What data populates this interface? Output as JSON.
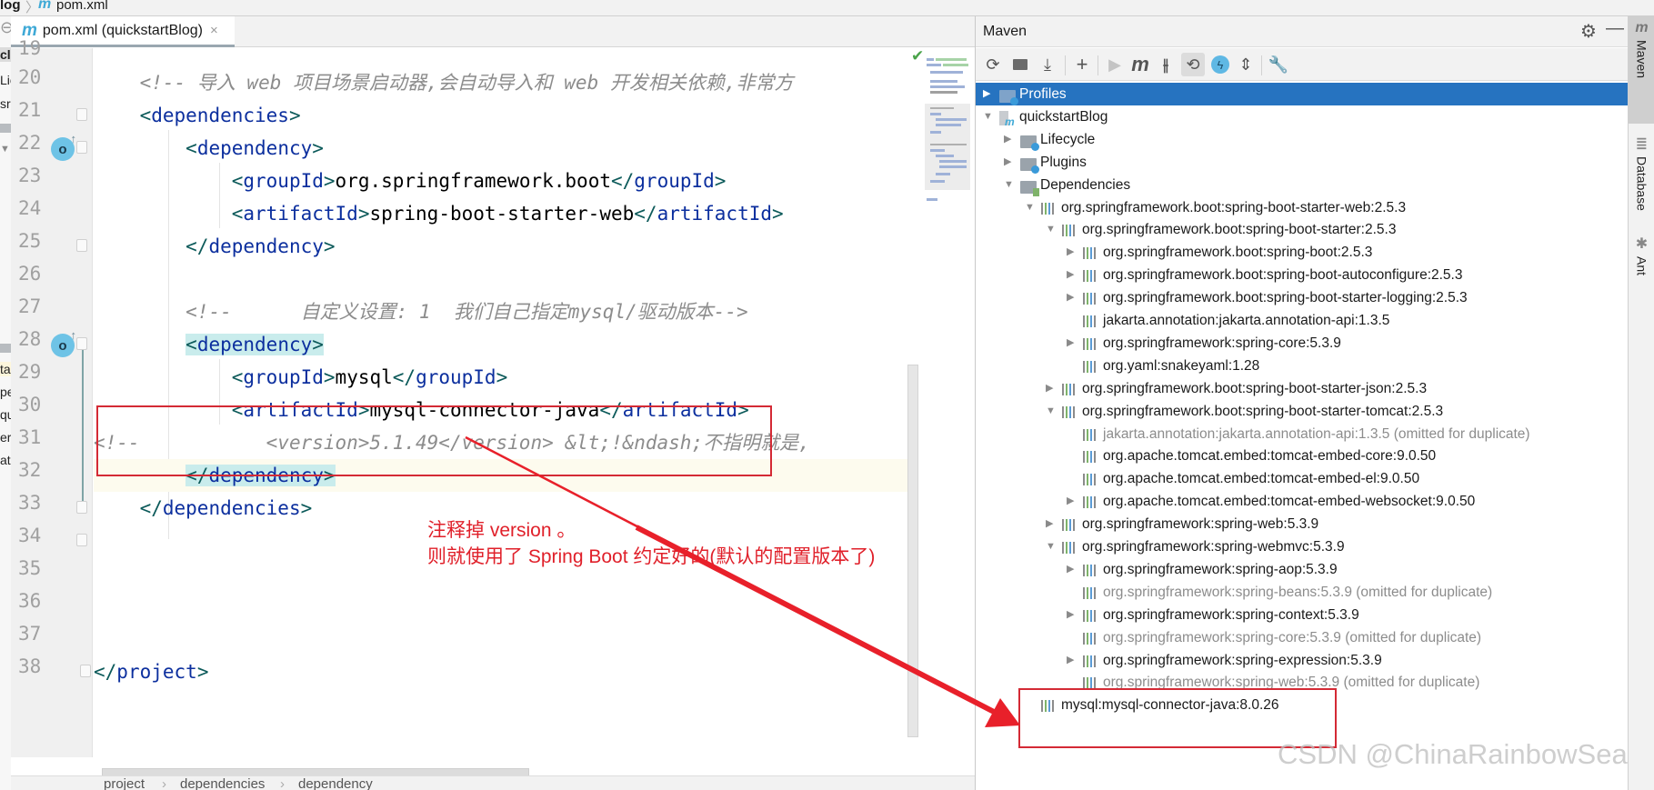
{
  "top_breadcrumb": {
    "project": "log",
    "file": "pom.xml"
  },
  "left_panel_fragments": [
    "cl",
    "Lic",
    "sr",
    "ta",
    "pe",
    "qu",
    "er",
    "at"
  ],
  "editor": {
    "tab": {
      "label": "pom.xml (quickstartBlog)",
      "icon": "maven-m-icon",
      "close": "×"
    },
    "line_numbers": [
      "19",
      "20",
      "21",
      "22",
      "23",
      "24",
      "25",
      "26",
      "27",
      "28",
      "29",
      "30",
      "31",
      "32",
      "33",
      "34",
      "35",
      "36",
      "37",
      "38"
    ],
    "lines": {
      "l20": "<!-- 导入 web 项目场景启动器,会自动导入和 web 开发相关依赖,非常方",
      "l21_open": "<",
      "l21_tag": "dependencies",
      "l21_close": ">",
      "l22_tag": "dependency",
      "l23_open_tag": "groupId",
      "l23_text": "org.springframework.boot",
      "l23_close_tag": "groupId",
      "l24_open_tag": "artifactId",
      "l24_text": "spring-boot-starter-web",
      "l24_close_tag": "artifactId",
      "l25_tag": "dependency",
      "l27": "<!--      自定义设置: 1  我们自己指定mysql/驱动版本-->",
      "l28_tag": "dependency",
      "l29_open_tag": "groupId",
      "l29_text": "mysql",
      "l29_close_tag": "groupId",
      "l30_open_tag": "artifactId",
      "l30_text": "mysql-connector-java",
      "l30_close_tag": "artifactId",
      "l31_a": "<!--",
      "l31_b": "<version>5.1.49</version> &lt;!&ndash;不指明就是,",
      "l32_tag": "dependency",
      "l33_tag": "dependencies",
      "l38_tag": "project"
    },
    "inspection_status": "✔",
    "breadcrumb": [
      "project",
      "dependencies",
      "dependency"
    ],
    "breadcrumb_sep": "›"
  },
  "annotation": {
    "note_line1": "注释掉 version 。",
    "note_line2": "则就使用了 Spring Boot 约定好的(默认的配置版本了)",
    "color": "#e0202a"
  },
  "maven": {
    "title": "Maven",
    "header_icons": [
      "gear-icon",
      "minimize-icon"
    ],
    "toolbar": [
      {
        "name": "reload-all-projects",
        "glyph": "⟳"
      },
      {
        "name": "generate-sources",
        "glyph": "▚"
      },
      {
        "name": "download-sources",
        "glyph": "⤓"
      },
      {
        "name": "add-maven-project",
        "glyph": "+"
      },
      {
        "name": "run-maven-build",
        "glyph": "▶"
      },
      {
        "name": "execute-maven-goal",
        "glyph": "m"
      },
      {
        "name": "toggle-offline-mode",
        "glyph": "⫲"
      },
      {
        "name": "toggle-skip-tests",
        "glyph": "⟲"
      },
      {
        "name": "show-dependencies",
        "glyph": "ϟ"
      },
      {
        "name": "collapse-all",
        "glyph": "⇕"
      },
      {
        "name": "maven-settings",
        "glyph": "🔧"
      }
    ],
    "tree": [
      {
        "label": "Profiles",
        "level": 0,
        "toggle": "▶",
        "icon": "profiles-folder",
        "selected": true
      },
      {
        "label": "quickstartBlog",
        "level": 0,
        "toggle": "▼",
        "icon": "maven-module"
      },
      {
        "label": "Lifecycle",
        "level": 1,
        "toggle": "▶",
        "icon": "gear-folder"
      },
      {
        "label": "Plugins",
        "level": 1,
        "toggle": "▶",
        "icon": "gear-folder"
      },
      {
        "label": "Dependencies",
        "level": 1,
        "toggle": "▼",
        "icon": "deps-folder"
      },
      {
        "label": "org.springframework.boot:spring-boot-starter-web:2.5.3",
        "level": 2,
        "toggle": "▼",
        "icon": "library"
      },
      {
        "label": "org.springframework.boot:spring-boot-starter:2.5.3",
        "level": 3,
        "toggle": "▼",
        "icon": "library"
      },
      {
        "label": "org.springframework.boot:spring-boot:2.5.3",
        "level": 4,
        "toggle": "▶",
        "icon": "library"
      },
      {
        "label": "org.springframework.boot:spring-boot-autoconfigure:2.5.3",
        "level": 4,
        "toggle": "▶",
        "icon": "library"
      },
      {
        "label": "org.springframework.boot:spring-boot-starter-logging:2.5.3",
        "level": 4,
        "toggle": "▶",
        "icon": "library"
      },
      {
        "label": "jakarta.annotation:jakarta.annotation-api:1.3.5",
        "level": 4,
        "toggle": "",
        "icon": "library"
      },
      {
        "label": "org.springframework:spring-core:5.3.9",
        "level": 4,
        "toggle": "▶",
        "icon": "library"
      },
      {
        "label": "org.yaml:snakeyaml:1.28",
        "level": 4,
        "toggle": "",
        "icon": "library"
      },
      {
        "label": "org.springframework.boot:spring-boot-starter-json:2.5.3",
        "level": 3,
        "toggle": "▶",
        "icon": "library"
      },
      {
        "label": "org.springframework.boot:spring-boot-starter-tomcat:2.5.3",
        "level": 3,
        "toggle": "▼",
        "icon": "library"
      },
      {
        "label": "jakarta.annotation:jakarta.annotation-api:1.3.5 (omitted for duplicate)",
        "level": 4,
        "toggle": "",
        "icon": "library",
        "omitted": true
      },
      {
        "label": "org.apache.tomcat.embed:tomcat-embed-core:9.0.50",
        "level": 4,
        "toggle": "",
        "icon": "library"
      },
      {
        "label": "org.apache.tomcat.embed:tomcat-embed-el:9.0.50",
        "level": 4,
        "toggle": "",
        "icon": "library"
      },
      {
        "label": "org.apache.tomcat.embed:tomcat-embed-websocket:9.0.50",
        "level": 4,
        "toggle": "▶",
        "icon": "library"
      },
      {
        "label": "org.springframework:spring-web:5.3.9",
        "level": 3,
        "toggle": "▶",
        "icon": "library"
      },
      {
        "label": "org.springframework:spring-webmvc:5.3.9",
        "level": 3,
        "toggle": "▼",
        "icon": "library"
      },
      {
        "label": "org.springframework:spring-aop:5.3.9",
        "level": 4,
        "toggle": "▶",
        "icon": "library"
      },
      {
        "label": "org.springframework:spring-beans:5.3.9 (omitted for duplicate)",
        "level": 4,
        "toggle": "",
        "icon": "library",
        "omitted": true
      },
      {
        "label": "org.springframework:spring-context:5.3.9",
        "level": 4,
        "toggle": "▶",
        "icon": "library"
      },
      {
        "label": "org.springframework:spring-core:5.3.9 (omitted for duplicate)",
        "level": 4,
        "toggle": "",
        "icon": "library",
        "omitted": true
      },
      {
        "label": "org.springframework:spring-expression:5.3.9",
        "level": 4,
        "toggle": "▶",
        "icon": "library"
      },
      {
        "label": "org.springframework:spring-web:5.3.9 (omitted for duplicate)",
        "level": 4,
        "toggle": "",
        "icon": "library",
        "omitted": true
      },
      {
        "label": "mysql:mysql-connector-java:8.0.26",
        "level": 2,
        "toggle": "",
        "icon": "library"
      }
    ],
    "selection_color": "#2673c0"
  },
  "right_tool_strip": [
    {
      "label": "Maven",
      "icon": "m",
      "active": true
    },
    {
      "label": "Database",
      "icon": "≣",
      "active": false
    },
    {
      "label": "Ant",
      "icon": "✱",
      "active": false
    }
  ],
  "watermark": "CSDN @ChinaRainbowSea"
}
